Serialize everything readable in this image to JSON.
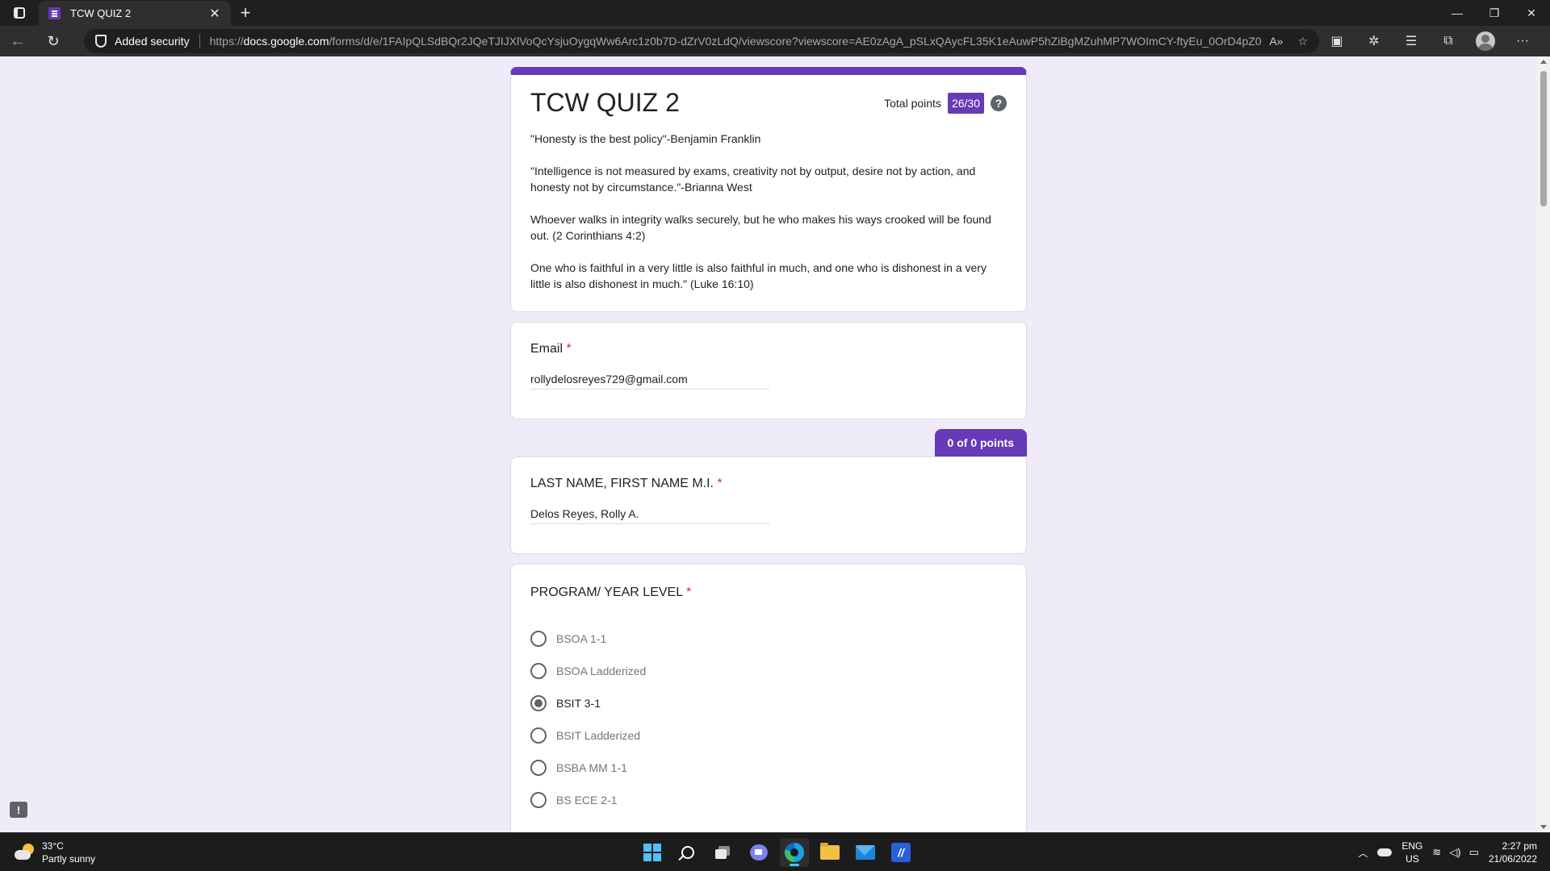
{
  "browser": {
    "tab_title": "TCW QUIZ 2",
    "security_label": "Added security",
    "url_prefix": "https://",
    "url_host": "docs.google.com",
    "url_path": "/forms/d/e/1FAIpQLSdBQr2JQeTJIJXlVoQcYsjuOygqWw6Arc1z0b7D-dZrV0zLdQ/viewscore?viewscore=AE0zAgA_pSLxQAycFL35K1eAuwP5hZiBgMZuhMP7WOImCY-ftyEu_0OrD4pZ0We..."
  },
  "form": {
    "title": "TCW QUIZ 2",
    "total_points_label": "Total points",
    "total_points": "26/30",
    "help_glyph": "?",
    "description": [
      "\"Honesty is the best policy\"-Benjamin Franklin",
      "\"Intelligence is not measured by exams, creativity not by output, desire not by action, and honesty not by circumstance.\"-Brianna West",
      "Whoever walks in integrity walks securely, but he who makes his ways crooked will be found out. (2 Corinthians 4:2)",
      "One who is faithful in a very little is also faithful in much, and one who is dishonest in a very little is also dishonest in much.\" (Luke 16:10)"
    ],
    "email": {
      "label": "Email",
      "required_mark": "*",
      "value": "rollydelosreyes729@gmail.com"
    },
    "section_points": "0 of 0 points",
    "name_question": {
      "label": "LAST NAME, FIRST NAME M.I.",
      "required_mark": "*",
      "value": "Delos Reyes, Rolly A."
    },
    "program_question": {
      "label": "PROGRAM/ YEAR LEVEL",
      "required_mark": "*",
      "options": [
        {
          "label": "BSOA 1-1",
          "selected": false
        },
        {
          "label": "BSOA Ladderized",
          "selected": false
        },
        {
          "label": "BSIT 3-1",
          "selected": true
        },
        {
          "label": "BSIT Ladderized",
          "selected": false
        },
        {
          "label": "BSBA MM 1-1",
          "selected": false
        },
        {
          "label": "BS ECE 2-1",
          "selected": false
        }
      ]
    },
    "report_glyph": "!"
  },
  "taskbar": {
    "temperature": "33°C",
    "weather": "Partly sunny",
    "lang_top": "ENG",
    "lang_bottom": "US",
    "time": "2:27 pm",
    "date": "21/06/2022"
  },
  "colors": {
    "accent": "#673ab7",
    "background": "#f0ebf8",
    "required": "#d93025"
  }
}
